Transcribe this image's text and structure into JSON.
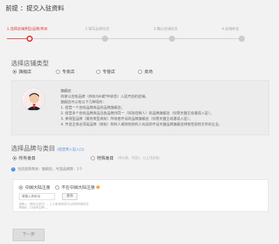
{
  "header": {
    "title": "前提 ：提交入驻资料"
  },
  "steps": [
    {
      "label": "1.选择店铺类型/品牌/类目",
      "active": true
    },
    {
      "label": "2.填写品牌信息",
      "active": false
    },
    {
      "label": "3.确认店铺信息",
      "active": false
    },
    {
      "label": "4.店铺命名",
      "active": false
    }
  ],
  "store_type": {
    "title": "选择店铺类型",
    "options": [
      {
        "label": "旗舰店",
        "checked": true
      },
      {
        "label": "专卖店",
        "checked": false
      },
      {
        "label": "专营店",
        "checked": false
      },
      {
        "label": "卖场",
        "checked": false
      }
    ]
  },
  "info_box": {
    "name": "旗舰店",
    "lines": [
      "商家以自有品牌（商标为R或TM状态）入驻开店的店铺。",
      "旗舰店可以有以下几种情形：",
      "1. 经营一个自有品牌商品的品牌旗舰店；",
      "2. 经营多个自有品牌商品且各品牌归同一（实际控制人）的品牌旗舰店（仅限天猫主动邀请入驻）；",
      "3. 卖场型品牌（服务类型商标）所有者开设的品牌旗舰店（仅限天猫主动邀请入驻）；",
      "4. 开店主体必须是品牌（商标）权利人或持有权利人出具的开设天猫品牌旗舰店排他性授权文件的企业。"
    ]
  },
  "brand_category": {
    "title": "选择品牌与类目",
    "link": "(经营类入驻入口)",
    "options": [
      {
        "label": "所有类目",
        "checked": true,
        "hint": ""
      },
      {
        "label": "特殊类目",
        "checked": false,
        "hint": "（有大类，可选1，以上可多选）"
      }
    ],
    "notice": "当前选择类目：旗舰店，可选品牌数：1个"
  },
  "brand_origin": {
    "options": [
      {
        "label": "中国大陆注册",
        "checked": true
      },
      {
        "label": "不在中国大陆注册",
        "checked": false
      }
    ],
    "input_placeholder": "请输入商标号",
    "query_label": "查询",
    "help_text": "请输入（商标注册号），上方查询按钮可以找到你要的品牌商标（可选择品牌）。"
  },
  "footer": {
    "next_label": "下一步"
  },
  "colors": {
    "accent": "#e4393c",
    "link": "#5a8fd8",
    "info": "#4a90e2",
    "warning": "#f0ad4e"
  }
}
